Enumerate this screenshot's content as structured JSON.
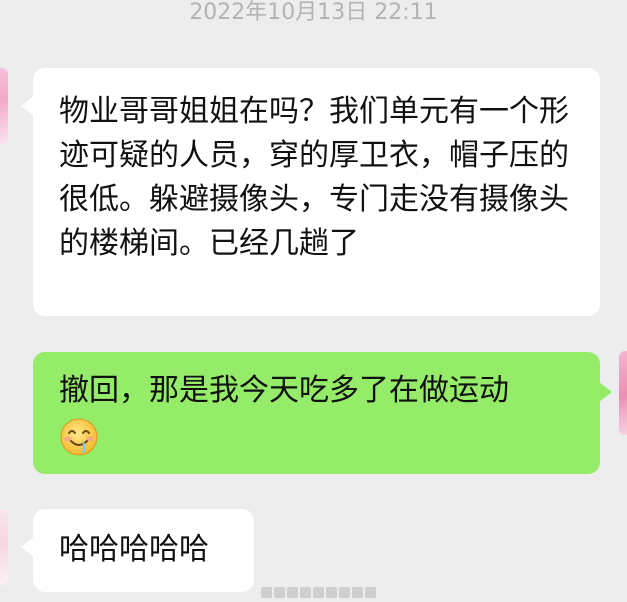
{
  "chat": {
    "timestamp": "2022年10月13日 22:11",
    "messages": [
      {
        "direction": "incoming",
        "text": "物业哥哥姐姐在吗？我们单元有一个形迹可疑的人员，穿的厚卫衣，帽子压的很低。躲避摄像头，专门走没有摄像头的楼梯间。已经几趟了"
      },
      {
        "direction": "outgoing",
        "text": "撤回，那是我今天吃多了在做运动",
        "emoji": "drooling-face-icon"
      },
      {
        "direction": "incoming",
        "text": "哈哈哈哈哈"
      }
    ]
  },
  "colors": {
    "background": "#ededed",
    "incoming_bubble": "#ffffff",
    "outgoing_bubble": "#95ec69",
    "timestamp_text": "#b4b4b4"
  }
}
